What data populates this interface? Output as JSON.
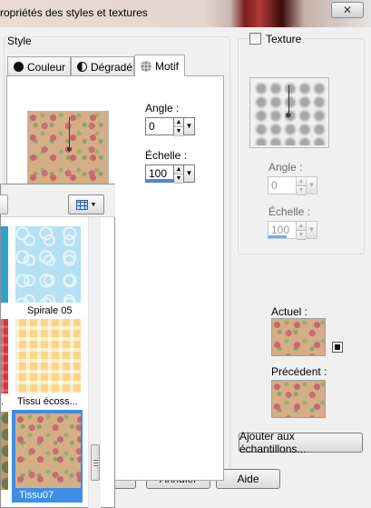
{
  "window": {
    "title": "ropriétés des styles et textures",
    "close_symbol": "✕"
  },
  "style_group": {
    "label": "Style",
    "tabs": [
      {
        "label": "Couleur",
        "icon": "circle-fill-icon"
      },
      {
        "label": "Dégradé",
        "icon": "half-circle-icon"
      },
      {
        "label": "Motif",
        "icon": "pattern-dots-icon",
        "active": true
      }
    ],
    "angle": {
      "label": "Angle :",
      "value": "0"
    },
    "echelle": {
      "label": "Échelle :",
      "value": "100",
      "fill_percent": 100
    }
  },
  "motif_popup": {
    "thumbnails": [
      {
        "name": "Spirale 05",
        "texture": "blue-spirals"
      },
      {
        "name": "Tissu écoss...",
        "texture": "yellow-plaid"
      },
      {
        "name": "Tissu07",
        "texture": "floral-beige",
        "selected": true
      }
    ]
  },
  "texture_group": {
    "checkbox_label": "Texture",
    "checked": false,
    "angle": {
      "label": "Angle :",
      "value": "0"
    },
    "echelle": {
      "label": "Échelle :",
      "value": "100",
      "fill_percent": 100
    }
  },
  "actuel_label": "Actuel :",
  "precedent_label": "Précédent :",
  "buttons": {
    "add_swatches": "Ajouter aux échantillons...",
    "cancel": "Annuler",
    "help": "Aide"
  },
  "colors": {
    "selection": "#3c8ee6",
    "accent_red": "#7a1c1c"
  }
}
